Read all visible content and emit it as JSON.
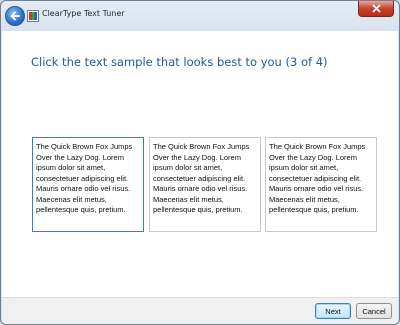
{
  "window": {
    "title": "ClearType Text Tuner",
    "icons": {
      "back": "back-arrow-icon",
      "app": "cleartype-app-icon",
      "close": "close-icon"
    }
  },
  "main": {
    "heading": "Click the text sample that looks best to you (3 of 4)",
    "samples": [
      {
        "text": "The Quick Brown Fox Jumps Over the Lazy Dog. Lorem ipsum dolor sit amet, consectetuer adipiscing elit. Mauris ornare odio vel risus. Maecenas elit metus, pellentesque quis, pretium.",
        "selected": true
      },
      {
        "text": "The Quick Brown Fox Jumps Over the Lazy Dog. Lorem ipsum dolor sit amet, consectetuer adipiscing elit. Mauris ornare odio vel risus. Maecenas elit metus, pellentesque quis, pretium.",
        "selected": false
      },
      {
        "text": "The Quick Brown Fox Jumps Over the Lazy Dog. Lorem ipsum dolor sit amet, consectetuer adipiscing elit. Mauris ornare odio vel risus. Maecenas elit metus, pellentesque quis, pretium.",
        "selected": false
      }
    ]
  },
  "footer": {
    "next_label": "Next",
    "cancel_label": "Cancel"
  },
  "colors": {
    "accent": "#1e5b9a",
    "selection_border": "#3b7ed0",
    "close_red": "#c7432c"
  }
}
